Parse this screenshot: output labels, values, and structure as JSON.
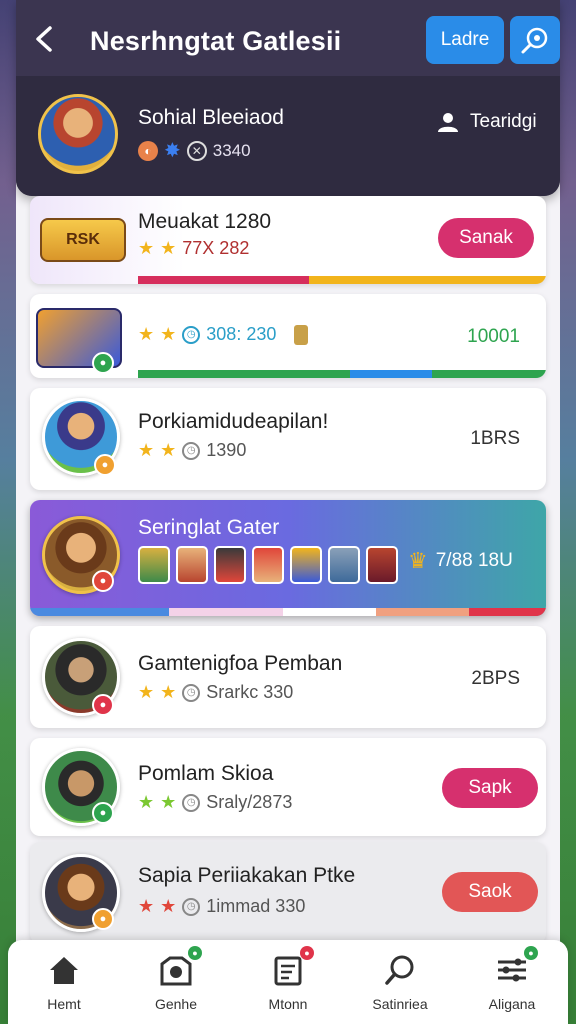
{
  "header": {
    "title": "Nesrhngtat Gatlesii",
    "ladder_button": "Ladre",
    "profile": {
      "name": "Sohial Bleeiaod",
      "meta": "3340",
      "tag": "Tearidgi"
    }
  },
  "rows": [
    {
      "name": "Meuakat 1280",
      "meta": "77X 282",
      "action": "Sanak",
      "action_color": "#d6306e"
    },
    {
      "name": "",
      "meta": "308: 230",
      "right": "10001",
      "right_color": "#2ea44f"
    },
    {
      "name": "Porkiamidudeapilan!",
      "meta": "1390",
      "right": "1BRS"
    },
    {
      "name": "Gamtenigfoa Pemban",
      "meta": "Srarkc 330",
      "right": "2BPS"
    },
    {
      "name": "Pomlam Skioa",
      "meta": "Sraly/2873",
      "action": "Sapk",
      "action_color": "#d6306e"
    },
    {
      "name": "Sapia Periiakakan Ptke",
      "meta": "1immad 330",
      "action": "Saok",
      "action_color": "#e25656"
    }
  ],
  "highlight": {
    "title": "Seringlat Gater",
    "value": "7/88 18U"
  },
  "nav": [
    {
      "label": "Hemt"
    },
    {
      "label": "Genhe"
    },
    {
      "label": "Mtonn"
    },
    {
      "label": "Satinriea"
    },
    {
      "label": "Aligana"
    }
  ],
  "colors": {
    "accent_blue": "#2a8ce8",
    "header_bg": "#3b3550",
    "star_gold": "#f2b41c"
  }
}
